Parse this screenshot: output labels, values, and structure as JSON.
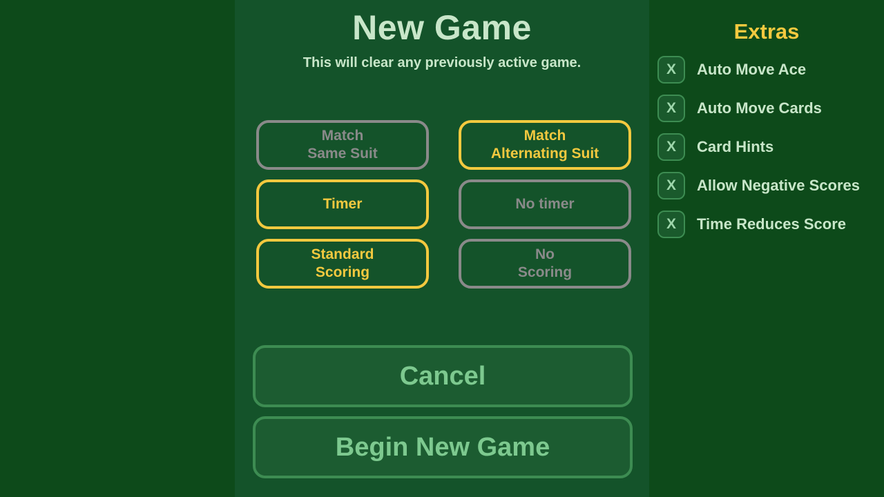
{
  "theme": {
    "background": "#0d4a1a",
    "panel": "#14532a",
    "accent_yellow": "#f3c93f",
    "muted_gray": "#8a8a8a",
    "light_green_text": "#c8e6c9",
    "button_green": "#7dc98f"
  },
  "dialog": {
    "title": "New Game",
    "subtitle": "This will clear any previously active game."
  },
  "options": [
    {
      "left": {
        "label": "Match\nSame Suit",
        "selected": false
      },
      "right": {
        "label": "Match\nAlternating Suit",
        "selected": true
      }
    },
    {
      "left": {
        "label": "Timer",
        "selected": true
      },
      "right": {
        "label": "No timer",
        "selected": false
      }
    },
    {
      "left": {
        "label": "Standard\nScoring",
        "selected": true
      },
      "right": {
        "label": "No\nScoring",
        "selected": false
      }
    }
  ],
  "actions": {
    "cancel_label": "Cancel",
    "begin_label": "Begin New Game"
  },
  "extras": {
    "title": "Extras",
    "check_mark": "X",
    "items": [
      {
        "label": "Auto Move Ace",
        "mark": "X"
      },
      {
        "label": "Auto Move Cards",
        "mark": "X"
      },
      {
        "label": "Card Hints",
        "mark": "X"
      },
      {
        "label": "Allow Negative Scores",
        "mark": "X"
      },
      {
        "label": "Time Reduces Score",
        "mark": "X"
      }
    ]
  }
}
